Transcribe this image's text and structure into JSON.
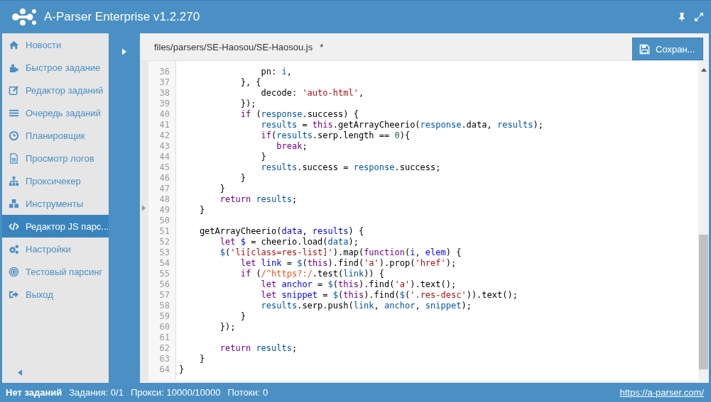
{
  "window": {
    "title": "A-Parser Enterprise v1.2.270"
  },
  "sidebar": {
    "items": [
      {
        "label": "Новости",
        "selected": false
      },
      {
        "label": "Быстрое задание",
        "selected": false
      },
      {
        "label": "Редактор заданий",
        "selected": false
      },
      {
        "label": "Очередь заданий",
        "selected": false
      },
      {
        "label": "Планировщик",
        "selected": false
      },
      {
        "label": "Просмотр логов",
        "selected": false
      },
      {
        "label": "Проксичекер",
        "selected": false
      },
      {
        "label": "Инструменты",
        "selected": false
      },
      {
        "label": "Редактор JS парс...",
        "selected": true
      },
      {
        "label": "Настройки",
        "selected": false
      },
      {
        "label": "Тестовый парсинг",
        "selected": false
      },
      {
        "label": "Выход",
        "selected": false
      }
    ]
  },
  "toolbar": {
    "file_path": "files/parsers/SE-Haosou/SE-Haosou.js",
    "modified_mark": "*",
    "save_button": "Сохран..."
  },
  "editor": {
    "lines": [
      {
        "number": "36",
        "tokens": [
          {
            "kind": "plain",
            "text": "                pn: "
          },
          {
            "kind": "var",
            "text": "i"
          },
          {
            "kind": "plain",
            "text": ","
          }
        ]
      },
      {
        "number": "37",
        "tokens": [
          {
            "kind": "plain",
            "text": "            }, {"
          }
        ]
      },
      {
        "number": "38",
        "tokens": [
          {
            "kind": "plain",
            "text": "                decode: "
          },
          {
            "kind": "str",
            "text": "'auto-html'"
          },
          {
            "kind": "plain",
            "text": ","
          }
        ]
      },
      {
        "number": "39",
        "tokens": [
          {
            "kind": "plain",
            "text": "            });"
          }
        ]
      },
      {
        "number": "40",
        "tokens": [
          {
            "kind": "kw",
            "text": "            if"
          },
          {
            "kind": "plain",
            "text": " ("
          },
          {
            "kind": "var",
            "text": "response"
          },
          {
            "kind": "plain",
            "text": ".success) {"
          }
        ]
      },
      {
        "number": "41",
        "tokens": [
          {
            "kind": "var",
            "text": "                results"
          },
          {
            "kind": "plain",
            "text": " = "
          },
          {
            "kind": "kw",
            "text": "this"
          },
          {
            "kind": "plain",
            "text": ".getArrayCheerio("
          },
          {
            "kind": "var",
            "text": "response"
          },
          {
            "kind": "plain",
            "text": ".data, "
          },
          {
            "kind": "var",
            "text": "results"
          },
          {
            "kind": "plain",
            "text": ");"
          }
        ]
      },
      {
        "number": "42",
        "tokens": [
          {
            "kind": "kw",
            "text": "                if"
          },
          {
            "kind": "plain",
            "text": "("
          },
          {
            "kind": "var",
            "text": "results"
          },
          {
            "kind": "plain",
            "text": ".serp.length == "
          },
          {
            "kind": "num",
            "text": "0"
          },
          {
            "kind": "plain",
            "text": "){"
          }
        ]
      },
      {
        "number": "43",
        "tokens": [
          {
            "kind": "kw",
            "text": "                   break"
          },
          {
            "kind": "plain",
            "text": ";"
          }
        ]
      },
      {
        "number": "44",
        "tokens": [
          {
            "kind": "plain",
            "text": "                }"
          }
        ]
      },
      {
        "number": "45",
        "tokens": [
          {
            "kind": "var",
            "text": "                results"
          },
          {
            "kind": "plain",
            "text": ".success = "
          },
          {
            "kind": "var",
            "text": "response"
          },
          {
            "kind": "plain",
            "text": ".success;"
          }
        ]
      },
      {
        "number": "46",
        "tokens": [
          {
            "kind": "plain",
            "text": "            }"
          }
        ]
      },
      {
        "number": "47",
        "tokens": [
          {
            "kind": "plain",
            "text": "        }"
          }
        ]
      },
      {
        "number": "48",
        "tokens": [
          {
            "kind": "kw",
            "text": "        return "
          },
          {
            "kind": "var",
            "text": "results"
          },
          {
            "kind": "plain",
            "text": ";"
          }
        ]
      },
      {
        "number": "49",
        "tokens": [
          {
            "kind": "plain",
            "text": "    }"
          }
        ]
      },
      {
        "number": "50"
      },
      {
        "number": "51",
        "tokens": [
          {
            "kind": "plain",
            "text": "    getArrayCheerio("
          },
          {
            "kind": "def",
            "text": "data"
          },
          {
            "kind": "plain",
            "text": ", "
          },
          {
            "kind": "def",
            "text": "results"
          },
          {
            "kind": "plain",
            "text": ") {"
          }
        ]
      },
      {
        "number": "52",
        "tokens": [
          {
            "kind": "kw",
            "text": "        let "
          },
          {
            "kind": "def",
            "text": "$"
          },
          {
            "kind": "plain",
            "text": " = cheerio.load("
          },
          {
            "kind": "var",
            "text": "data"
          },
          {
            "kind": "plain",
            "text": ");"
          }
        ]
      },
      {
        "number": "53",
        "tokens": [
          {
            "kind": "var",
            "text": "        $"
          },
          {
            "kind": "plain",
            "text": "("
          },
          {
            "kind": "str",
            "text": "'li[class=res-list]'"
          },
          {
            "kind": "plain",
            "text": ").map("
          },
          {
            "kind": "kw",
            "text": "function"
          },
          {
            "kind": "plain",
            "text": "("
          },
          {
            "kind": "def",
            "text": "i"
          },
          {
            "kind": "plain",
            "text": ", "
          },
          {
            "kind": "def",
            "text": "elem"
          },
          {
            "kind": "plain",
            "text": ") {"
          }
        ]
      },
      {
        "number": "54",
        "tokens": [
          {
            "kind": "kw",
            "text": "            let "
          },
          {
            "kind": "def",
            "text": "link"
          },
          {
            "kind": "plain",
            "text": " = "
          },
          {
            "kind": "var",
            "text": "$"
          },
          {
            "kind": "plain",
            "text": "("
          },
          {
            "kind": "kw",
            "text": "this"
          },
          {
            "kind": "plain",
            "text": ").find("
          },
          {
            "kind": "str",
            "text": "'a'"
          },
          {
            "kind": "plain",
            "text": ").prop("
          },
          {
            "kind": "str",
            "text": "'href'"
          },
          {
            "kind": "plain",
            "text": ");"
          }
        ]
      },
      {
        "number": "55",
        "tokens": [
          {
            "kind": "kw",
            "text": "            if"
          },
          {
            "kind": "plain",
            "text": " ("
          },
          {
            "kind": "regex",
            "text": "/^https?:/"
          },
          {
            "kind": "plain",
            "text": ".test("
          },
          {
            "kind": "var",
            "text": "link"
          },
          {
            "kind": "plain",
            "text": ")) {"
          }
        ]
      },
      {
        "number": "56",
        "tokens": [
          {
            "kind": "kw",
            "text": "                let "
          },
          {
            "kind": "def",
            "text": "anchor"
          },
          {
            "kind": "plain",
            "text": " = "
          },
          {
            "kind": "var",
            "text": "$"
          },
          {
            "kind": "plain",
            "text": "("
          },
          {
            "kind": "kw",
            "text": "this"
          },
          {
            "kind": "plain",
            "text": ").find("
          },
          {
            "kind": "str",
            "text": "'a'"
          },
          {
            "kind": "plain",
            "text": ").text();"
          }
        ]
      },
      {
        "number": "57",
        "tokens": [
          {
            "kind": "kw",
            "text": "                let "
          },
          {
            "kind": "def",
            "text": "snippet"
          },
          {
            "kind": "plain",
            "text": " = "
          },
          {
            "kind": "var",
            "text": "$"
          },
          {
            "kind": "plain",
            "text": "("
          },
          {
            "kind": "kw",
            "text": "this"
          },
          {
            "kind": "plain",
            "text": ").find("
          },
          {
            "kind": "var",
            "text": "$"
          },
          {
            "kind": "plain",
            "text": "("
          },
          {
            "kind": "str",
            "text": "'.res-desc'"
          },
          {
            "kind": "plain",
            "text": ")).text();"
          }
        ]
      },
      {
        "number": "58",
        "tokens": [
          {
            "kind": "var",
            "text": "                results"
          },
          {
            "kind": "plain",
            "text": ".serp.push("
          },
          {
            "kind": "var",
            "text": "link"
          },
          {
            "kind": "plain",
            "text": ", "
          },
          {
            "kind": "var",
            "text": "anchor"
          },
          {
            "kind": "plain",
            "text": ", "
          },
          {
            "kind": "var",
            "text": "snippet"
          },
          {
            "kind": "plain",
            "text": ");"
          }
        ]
      },
      {
        "number": "59",
        "tokens": [
          {
            "kind": "plain",
            "text": "            }"
          }
        ]
      },
      {
        "number": "60",
        "tokens": [
          {
            "kind": "plain",
            "text": "        });"
          }
        ]
      },
      {
        "number": "61"
      },
      {
        "number": "62",
        "tokens": [
          {
            "kind": "kw",
            "text": "        return "
          },
          {
            "kind": "var",
            "text": "results"
          },
          {
            "kind": "plain",
            "text": ";"
          }
        ]
      },
      {
        "number": "63",
        "tokens": [
          {
            "kind": "plain",
            "text": "    }"
          }
        ]
      },
      {
        "number": "64",
        "tokens": [
          {
            "kind": "plain",
            "text": "}"
          }
        ]
      }
    ]
  },
  "status_bar": {
    "state": "Нет заданий",
    "tasks": "Задания: 0/1",
    "proxies": "Прокси: 10000/10000",
    "threads": "Потоки: 0",
    "link": "https://a-parser.com/"
  }
}
